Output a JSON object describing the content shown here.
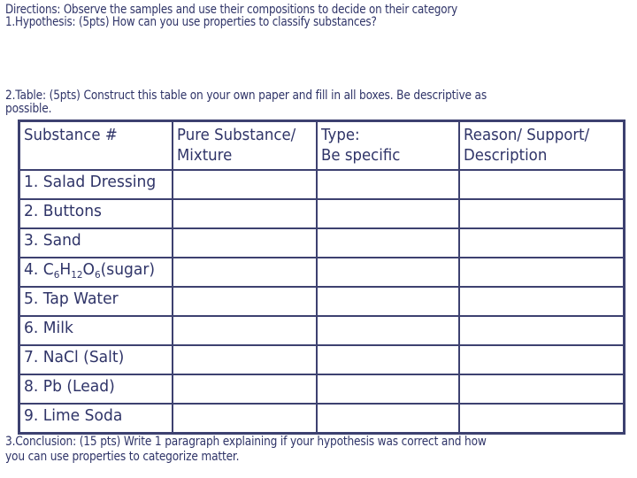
{
  "directions": "Directions: Observe the samples and use their compositions to decide on their category",
  "hypothesis": "1.Hypothesis: (5pts) How can you use properties to classify substances?",
  "table_instructions": {
    "line1": "2.Table: (5pts) Construct this table on your own paper and fill in all boxes. Be descriptive as",
    "line2": "possible."
  },
  "table": {
    "headers": [
      {
        "line1": "Substance #",
        "line2": ""
      },
      {
        "line1": "Pure Substance/",
        "line2": "Mixture"
      },
      {
        "line1": "Type:",
        "line2": "Be specific"
      },
      {
        "line1": "Reason/ Support/",
        "line2": "Description"
      }
    ],
    "rows": [
      "1. Salad Dressing",
      "2. Buttons",
      "3. Sand",
      {
        "prefix": "4. C",
        "sub1": "6",
        "h": "H",
        "sub2": "12",
        "o": "O",
        "sub3": "6",
        "suffix": "(sugar)"
      },
      "5. Tap Water",
      "6. Milk",
      "7. NaCl (Salt)",
      "8. Pb (Lead)",
      "9. Lime Soda"
    ]
  },
  "conclusion": {
    "line1": "3.Conclusion: (15 pts) Write 1 paragraph explaining if your hypothesis was correct and how",
    "line2": "you can use properties to categorize matter."
  }
}
